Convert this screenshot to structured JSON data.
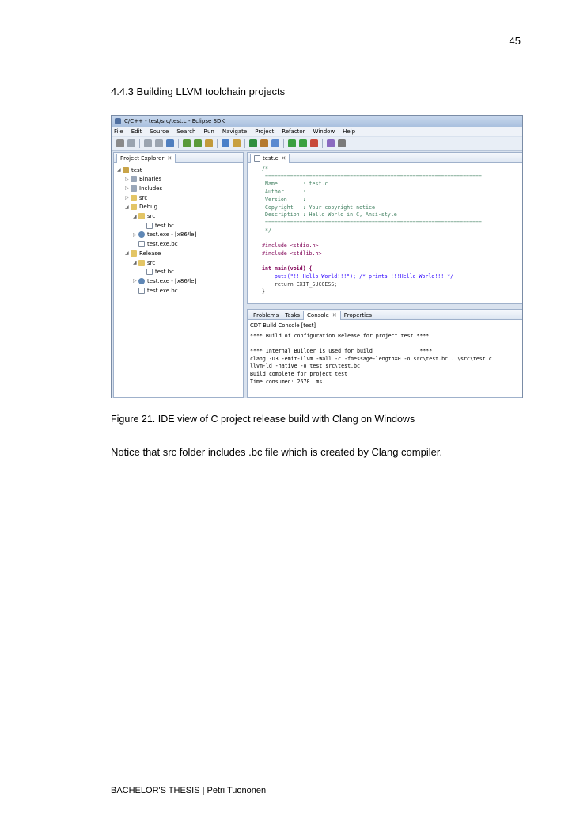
{
  "page": {
    "number": "45",
    "section_heading": "4.4.3   Building LLVM toolchain projects",
    "figure_caption": "Figure 21. IDE view of C project release build with Clang on Windows",
    "body_text": "Notice that src folder includes .bc file which is created by Clang compiler.",
    "footer": "BACHELOR'S THESIS | Petri Tuononen"
  },
  "ide": {
    "title": "C/C++ - test/src/test.c - Eclipse SDK",
    "menu": [
      "File",
      "Edit",
      "Source",
      "Search",
      "Run",
      "Navigate",
      "Project",
      "Refactor",
      "Window",
      "Help"
    ],
    "toolbar_icon_colors": [
      "#8a8a8a",
      "#9aa4b0",
      "#9aa4b0",
      "#9aa4b0",
      "#4f7fbf",
      "#5a9a3a",
      "#5a9a3a",
      "#c29a3a",
      "#4a80c8",
      "#c8a040",
      "#2f8f3f",
      "#b57a2f",
      "#5a8ad0",
      "#3aa040",
      "#3aa040",
      "#c84a3a",
      "#8a6ac0",
      "#7a7a7a"
    ],
    "explorer": {
      "tab": "Project Explorer",
      "tree": [
        {
          "label": "test",
          "icon": "project-icon",
          "arrow": "◢"
        },
        {
          "label": "Binaries",
          "icon": "binaries-icon",
          "arrow": "▷"
        },
        {
          "label": "Includes",
          "icon": "includes-icon",
          "arrow": "▷"
        },
        {
          "label": "src",
          "icon": "folder-icon",
          "arrow": "▷"
        },
        {
          "label": "Debug",
          "icon": "folder-icon",
          "arrow": "◢"
        },
        {
          "label": "src",
          "icon": "folder-icon",
          "arrow": "◢"
        },
        {
          "label": "test.bc",
          "icon": "file-icon",
          "arrow": ""
        },
        {
          "label": "test.exe - [x86/le]",
          "icon": "executable-icon",
          "arrow": "▷"
        },
        {
          "label": "test.exe.bc",
          "icon": "file-icon",
          "arrow": ""
        },
        {
          "label": "Release",
          "icon": "folder-icon",
          "arrow": "◢"
        },
        {
          "label": "src",
          "icon": "folder-icon",
          "arrow": "◢"
        },
        {
          "label": "test.bc",
          "icon": "file-icon",
          "arrow": ""
        },
        {
          "label": "test.exe - [x86/le]",
          "icon": "executable-icon",
          "arrow": "▷"
        },
        {
          "label": "test.exe.bc",
          "icon": "file-icon",
          "arrow": ""
        }
      ]
    },
    "editor": {
      "tab": "test.c",
      "code": [
        {
          "text": "/*",
          "cls": "c-comment"
        },
        {
          "text": " =====================================================================",
          "cls": "c-comment"
        },
        {
          "text": " Name        : test.c",
          "cls": "c-comment"
        },
        {
          "text": " Author      :",
          "cls": "c-comment"
        },
        {
          "text": " Version     :",
          "cls": "c-comment"
        },
        {
          "text": " Copyright   : Your copyright notice",
          "cls": "c-comment"
        },
        {
          "text": " Description : Hello World in C, Ansi-style",
          "cls": "c-comment"
        },
        {
          "text": " =====================================================================",
          "cls": "c-comment"
        },
        {
          "text": " */",
          "cls": "c-comment"
        },
        {
          "text": "",
          "cls": ""
        },
        {
          "text": "#include <stdio.h>",
          "cls": "c-pre"
        },
        {
          "text": "#include <stdlib.h>",
          "cls": "c-pre"
        },
        {
          "text": "",
          "cls": ""
        },
        {
          "text": "int main(void) {",
          "cls": "c-kw"
        },
        {
          "text": "    puts(\"!!!Hello World!!!\"); /* prints !!!Hello World!!! */",
          "cls": "c-str"
        },
        {
          "text": "    return EXIT_SUCCESS;",
          "cls": ""
        },
        {
          "text": "}",
          "cls": ""
        }
      ]
    },
    "bottom_tabs": [
      "Problems",
      "Tasks",
      "Console",
      "Properties"
    ],
    "console": {
      "label": "CDT Build Console [test]",
      "lines": [
        "**** Build of configuration Release for project test ****",
        "",
        "**** Internal Builder is used for build               ****",
        "clang -O3 -emit-llvm -Wall -c -fmessage-length=0 -o src\\test.bc ..\\src\\test.c",
        "llvm-ld -native -o test src\\test.bc",
        "Build complete for project test",
        "Time consumed: 2670  ms."
      ]
    }
  }
}
